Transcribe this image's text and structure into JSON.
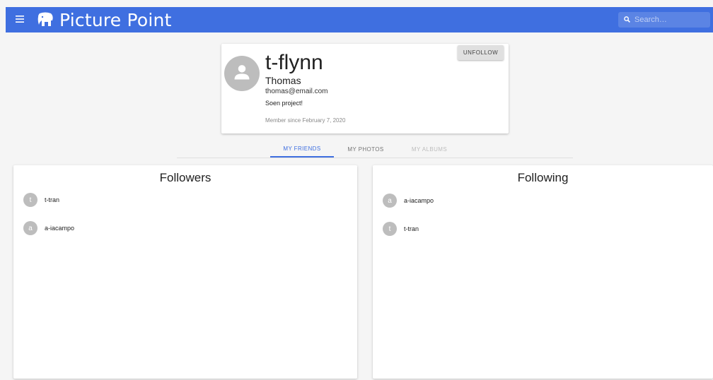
{
  "app": {
    "title": "Picture Point"
  },
  "icons": {
    "menu": "menu-icon",
    "logo": "elephant-logo-icon",
    "search": "search-icon",
    "avatar": "person-icon"
  },
  "search": {
    "placeholder": "Search…",
    "value": ""
  },
  "profile": {
    "username": "t-flynn",
    "name": "Thomas",
    "email": "thomas@email.com",
    "bio": "Soen project!",
    "member_since": "Member since February 7, 2020",
    "unfollow_label": "UNFOLLOW"
  },
  "tabs": [
    {
      "label": "MY FRIENDS",
      "state": "active"
    },
    {
      "label": "MY PHOTOS",
      "state": "normal"
    },
    {
      "label": "MY ALBUMS",
      "state": "disabled"
    }
  ],
  "followers": {
    "title": "Followers",
    "items": [
      {
        "initial": "t",
        "name": "t-tran"
      },
      {
        "initial": "a",
        "name": "a-iacampo"
      }
    ]
  },
  "following": {
    "title": "Following",
    "items": [
      {
        "initial": "a",
        "name": "a-iacampo"
      },
      {
        "initial": "t",
        "name": "t-tran"
      }
    ]
  },
  "colors": {
    "appbar": "#3f6fe0",
    "accent": "#3f6fe0",
    "avatar": "#bdbdbd"
  }
}
